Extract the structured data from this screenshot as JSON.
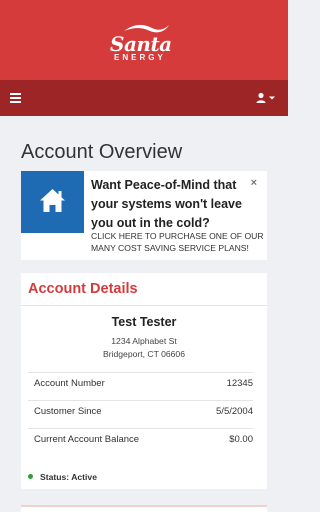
{
  "brand": {
    "name": "Santa",
    "sub": "ENERGY",
    "primary_color": "#d63b3c",
    "navbar_color": "#9d2526",
    "accent_blue": "#1e6bb3"
  },
  "navbar": {
    "menu_icon": "hamburger-menu-icon",
    "user_icon": "user-icon",
    "dropdown_icon": "caret-down-icon"
  },
  "page": {
    "title": "Account Overview"
  },
  "promo": {
    "icon": "home-icon",
    "headline": "Want Peace-of-Mind that your systems won't leave you out in the cold?",
    "close_label": "×",
    "link_text": "CLICK HERE TO PURCHASE ONE OF OUR MANY COST SAVING SERVICE PLANS!"
  },
  "account": {
    "title": "Account Details",
    "name": "Test Tester",
    "address_line1": "1234 Alphabet St",
    "address_line2": "Bridgeport, CT 06606",
    "rows": [
      {
        "label": "Account Number",
        "value": "12345"
      },
      {
        "label": "Customer Since",
        "value": "5/5/2004"
      },
      {
        "label": "Current Account Balance",
        "value": "$0.00"
      }
    ],
    "status": "Status: Active",
    "status_color": "#2e9e3b"
  }
}
